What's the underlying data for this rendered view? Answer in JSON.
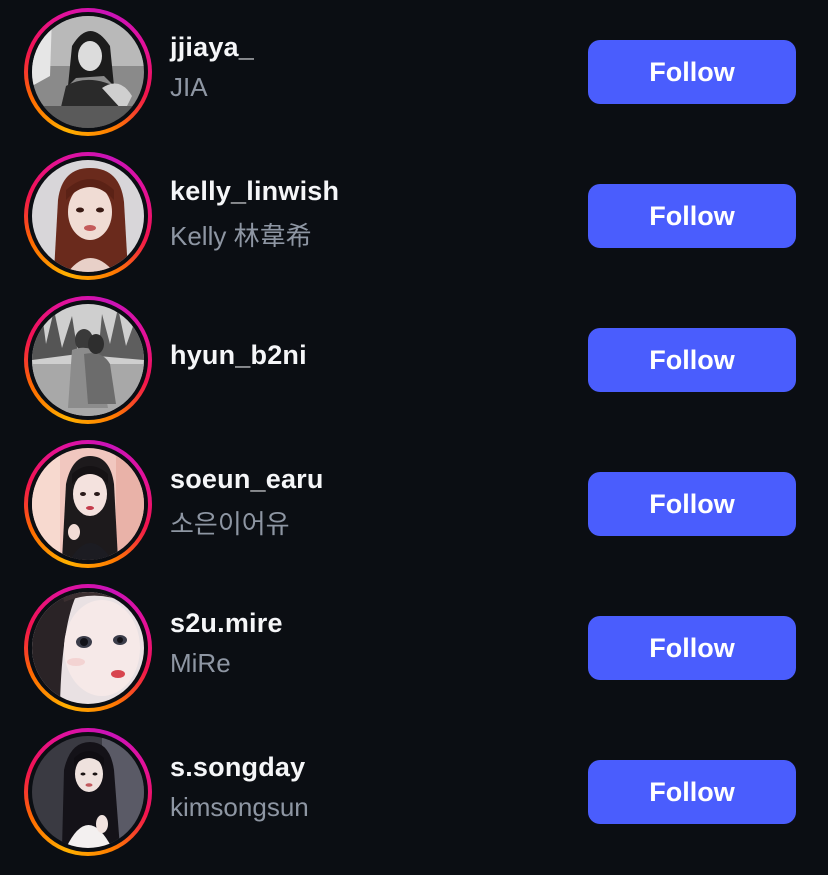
{
  "accounts": [
    {
      "username": "jjiaya_",
      "full_name": "JIA",
      "button_label": "Follow",
      "avatar_icon": "profile-photo-grayscale"
    },
    {
      "username": "kelly_linwish",
      "full_name": "Kelly 林韋希",
      "button_label": "Follow",
      "avatar_icon": "profile-photo-redhair"
    },
    {
      "username": "hyun_b2ni",
      "full_name": "",
      "button_label": "Follow",
      "avatar_icon": "profile-photo-grayscale-outdoor"
    },
    {
      "username": "soeun_earu",
      "full_name": "소은이어유",
      "button_label": "Follow",
      "avatar_icon": "profile-photo-pink"
    },
    {
      "username": "s2u.mire",
      "full_name": "MiRe",
      "button_label": "Follow",
      "avatar_icon": "profile-photo-closeup"
    },
    {
      "username": "s.songday",
      "full_name": "kimsongsun",
      "button_label": "Follow",
      "avatar_icon": "profile-photo-portrait"
    }
  ],
  "colors": {
    "background": "#0b0e13",
    "username": "#f5f6f8",
    "full_name": "#8e96a3",
    "follow_button": "#4a5dfd",
    "ring_gradient": [
      "#ffb000",
      "#ff6a00",
      "#f2134f",
      "#e3119a",
      "#c913b9"
    ]
  }
}
